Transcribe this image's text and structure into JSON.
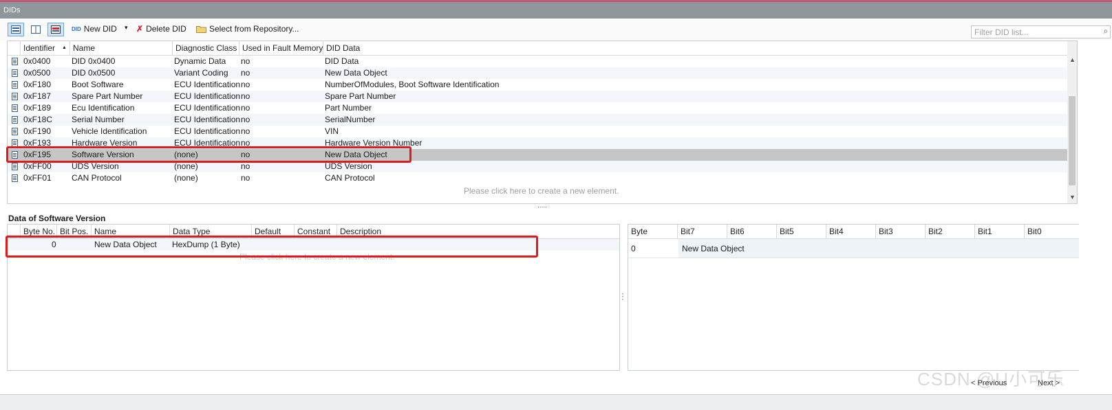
{
  "window": {
    "title": "DIDs"
  },
  "toolbar": {
    "new_did": "New DID",
    "delete_did": "Delete DID",
    "select_repo": "Select from Repository...",
    "filter_placeholder": "Filter DID list..."
  },
  "did_table": {
    "columns": [
      "Identifier",
      "Name",
      "Diagnostic Class",
      "Used in Fault Memory",
      "DID Data"
    ],
    "rows": [
      {
        "id": "0x0400",
        "name": "DID 0x0400",
        "class": "Dynamic Data",
        "fault": "no",
        "data": "DID Data"
      },
      {
        "id": "0x0500",
        "name": "DID 0x0500",
        "class": "Variant Coding",
        "fault": "no",
        "data": "New Data Object"
      },
      {
        "id": "0xF180",
        "name": "Boot Software",
        "class": "ECU Identification",
        "fault": "no",
        "data": "NumberOfModules, Boot Software Identification"
      },
      {
        "id": "0xF187",
        "name": "Spare Part Number",
        "class": "ECU Identification",
        "fault": "no",
        "data": "Spare Part Number"
      },
      {
        "id": "0xF189",
        "name": "Ecu Identification",
        "class": "ECU Identification",
        "fault": "no",
        "data": "Part Number"
      },
      {
        "id": "0xF18C",
        "name": "Serial Number",
        "class": "ECU Identification",
        "fault": "no",
        "data": "SerialNumber"
      },
      {
        "id": "0xF190",
        "name": "Vehicle Identification",
        "class": "ECU Identification",
        "fault": "no",
        "data": "VIN"
      },
      {
        "id": "0xF193",
        "name": "Hardware Version",
        "class": "ECU Identification",
        "fault": "no",
        "data": "Hardware Version Number"
      },
      {
        "id": "0xF195",
        "name": "Software Version",
        "class": "(none)",
        "fault": "no",
        "data": "New Data Object"
      },
      {
        "id": "0xFF00",
        "name": "UDS Version",
        "class": "(none)",
        "fault": "no",
        "data": "UDS Version"
      },
      {
        "id": "0xFF01",
        "name": "CAN Protocol",
        "class": "(none)",
        "fault": "no",
        "data": "CAN Protocol"
      }
    ],
    "create_hint": "Please click here to create a new element."
  },
  "splitter_grip": ".....",
  "data_section": {
    "title": "Data of Software Version",
    "columns": [
      "Byte No.",
      "Bit Pos.",
      "Name",
      "Data Type",
      "Default",
      "Constant",
      "Description"
    ],
    "rows": [
      {
        "byte": "0",
        "bitpos": "",
        "name": "New Data Object",
        "type": "HexDump (1 Byte)",
        "default": "",
        "constant": "",
        "desc": ""
      }
    ],
    "create_hint": "Please click here to create a new element."
  },
  "bit_layout": {
    "columns": [
      "Byte",
      "Bit7",
      "Bit6",
      "Bit5",
      "Bit4",
      "Bit3",
      "Bit2",
      "Bit1",
      "Bit0"
    ],
    "rows": [
      {
        "byte": "0",
        "object": "New Data Object"
      }
    ]
  },
  "pager": {
    "previous": "< Previous",
    "next": "Next >"
  },
  "watermark": "CSDN @U小可乐"
}
